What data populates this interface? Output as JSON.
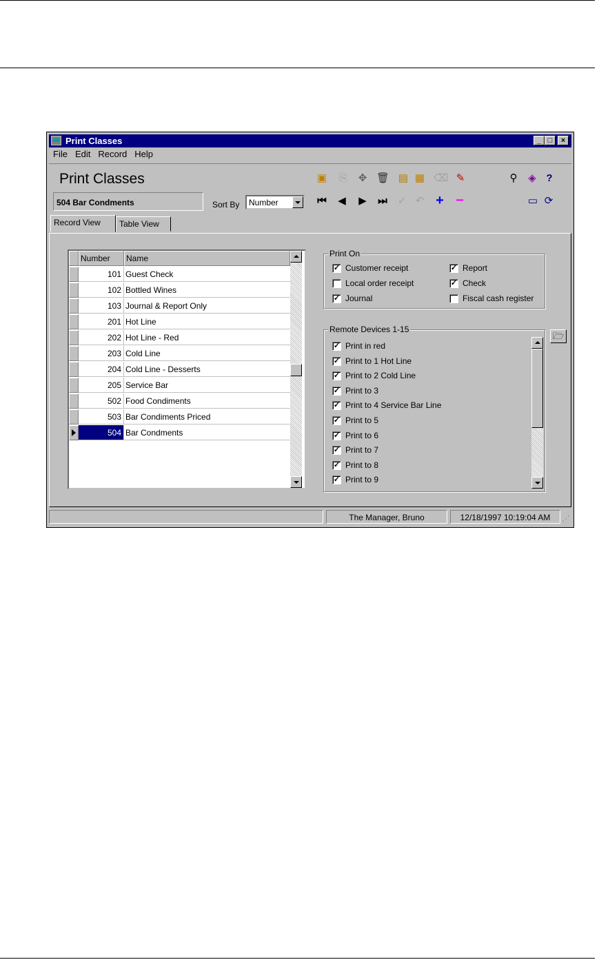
{
  "window": {
    "title": "Print Classes"
  },
  "window_buttons": {
    "minimize": "_",
    "maximize": "□",
    "close": "×"
  },
  "menu": [
    "File",
    "Edit",
    "Record",
    "Help"
  ],
  "header": {
    "title": "Print Classes",
    "current_record": "504 Bar Condments"
  },
  "sort": {
    "label": "Sort By",
    "value": "Number"
  },
  "toolbar_icons": [
    "new-record-icon",
    "copy-icon",
    "find-replace-icon",
    "delete-icon",
    "paste-icon",
    "report-icon",
    "clear-icon",
    "edit-icon",
    "find-icon",
    "help-book-icon",
    "context-help-icon",
    "first-record-icon",
    "prev-record-icon",
    "next-record-icon",
    "last-record-icon",
    "commit-icon",
    "undo-icon",
    "add-icon",
    "remove-icon",
    "monitor-icon",
    "refresh-icon"
  ],
  "tabs": [
    "Record View",
    "Table View"
  ],
  "table": {
    "columns": [
      "Number",
      "Name"
    ],
    "rows": [
      {
        "number": "101",
        "name": "Guest Check"
      },
      {
        "number": "102",
        "name": "Bottled Wines"
      },
      {
        "number": "103",
        "name": "Journal & Report Only"
      },
      {
        "number": "201",
        "name": "Hot Line"
      },
      {
        "number": "202",
        "name": "Hot Line - Red"
      },
      {
        "number": "203",
        "name": "Cold Line"
      },
      {
        "number": "204",
        "name": "Cold Line - Desserts"
      },
      {
        "number": "205",
        "name": "Service Bar"
      },
      {
        "number": "502",
        "name": "Food Condiments"
      },
      {
        "number": "503",
        "name": "Bar Condiments Priced"
      },
      {
        "number": "504",
        "name": "Bar Condments"
      }
    ],
    "selected_row": 10
  },
  "print_on": {
    "label": "Print On",
    "options": [
      {
        "label": "Customer receipt",
        "checked": true
      },
      {
        "label": "Local order receipt",
        "checked": false
      },
      {
        "label": "Journal",
        "checked": true
      },
      {
        "label": "Report",
        "checked": true
      },
      {
        "label": "Check",
        "checked": true
      },
      {
        "label": "Fiscal cash register",
        "checked": false
      }
    ]
  },
  "remote_devices": {
    "label": "Remote Devices 1-15",
    "items": [
      {
        "label": "Print in red",
        "checked": true
      },
      {
        "label": "Print to 1  Hot Line",
        "checked": true
      },
      {
        "label": "Print to 2  Cold Line",
        "checked": true
      },
      {
        "label": "Print to 3",
        "checked": true
      },
      {
        "label": "Print to 4  Service Bar Line",
        "checked": true
      },
      {
        "label": "Print to 5",
        "checked": true
      },
      {
        "label": "Print to 6",
        "checked": true
      },
      {
        "label": "Print to 7",
        "checked": true
      },
      {
        "label": "Print to 8",
        "checked": true
      },
      {
        "label": "Print to 9",
        "checked": true
      }
    ]
  },
  "status": {
    "user": "The Manager, Bruno",
    "datetime": "12/18/1997 10:19:04 AM"
  }
}
